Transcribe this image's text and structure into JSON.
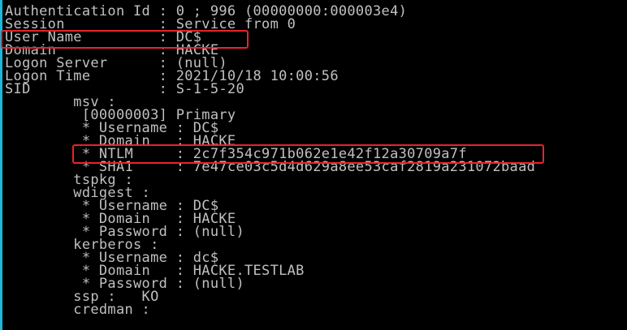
{
  "console": {
    "lines": [
      "Authentication Id : 0 ; 996 (00000000:000003e4)",
      "Session           : Service from 0",
      "User Name         : DC$",
      "Domain            : HACKE",
      "Logon Server      : (null)",
      "Logon Time        : 2021/10/18 10:00:56",
      "SID               : S-1-5-20",
      "        msv :",
      "         [00000003] Primary",
      "         * Username : DC$",
      "         * Domain   : HACKE",
      "         * NTLM     : 2c7f354c971b062e1e42f12a30709a7f",
      "         * SHA1     : 7e47ce03c5d4d629a8ee53caf2819a231072baad",
      "        tspkg :",
      "        wdigest :",
      "         * Username : DC$",
      "         * Domain   : HACKE",
      "         * Password : (null)",
      "        kerberos :",
      "         * Username : dc$",
      "         * Domain   : HACKE.TESTLAB",
      "         * Password : (null)",
      "        ssp :   KO",
      "        credman :"
    ]
  },
  "highlight_color": "#e8242a",
  "text_color": "#c0c0c0",
  "background_color": "#000000"
}
